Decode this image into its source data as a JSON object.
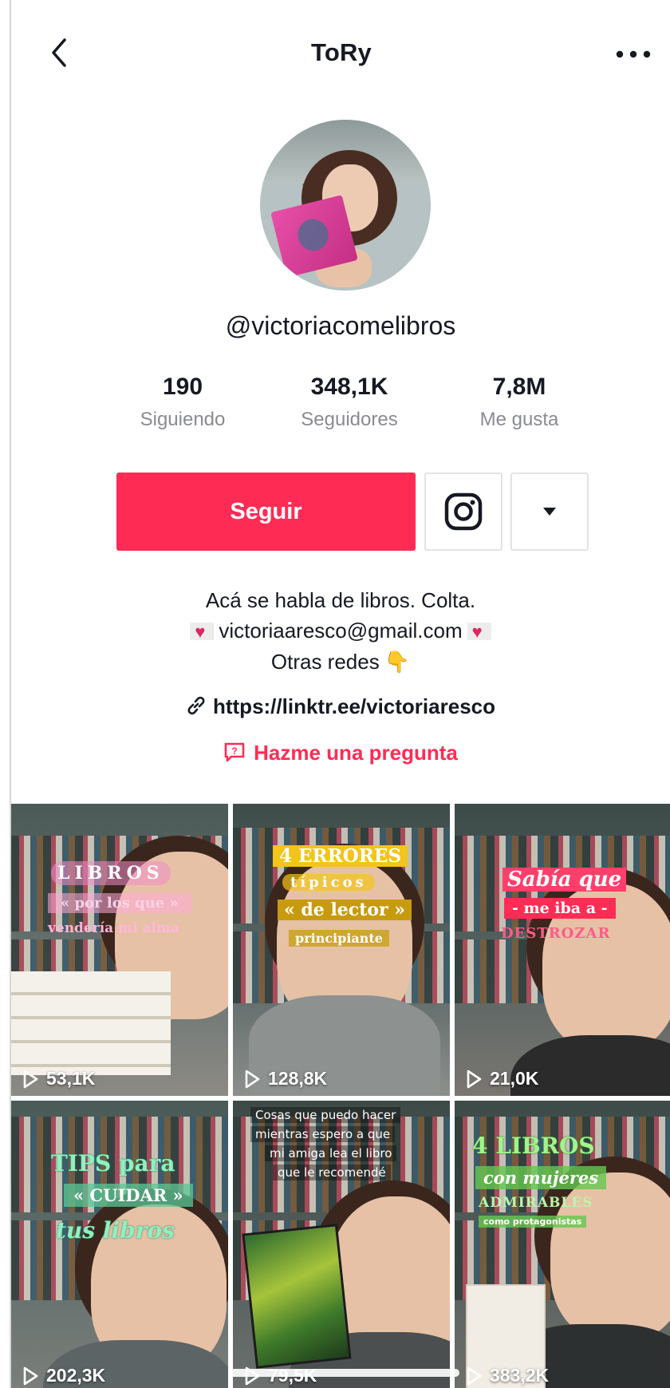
{
  "header": {
    "title": "ToRy"
  },
  "profile": {
    "username": "@victoriacomelibros",
    "stats": [
      {
        "value": "190",
        "label": "Siguiendo"
      },
      {
        "value": "348,1K",
        "label": "Seguidores"
      },
      {
        "value": "7,8M",
        "label": "Me gusta"
      }
    ],
    "follow_label": "Seguir",
    "bio": {
      "line1": "Acá se habla de libros. Colta.",
      "email": "victoriaaresco@gmail.com",
      "line3": "Otras redes"
    },
    "link": "https://linktr.ee/victoriaresco",
    "ask_label": "Hazme una pregunta"
  },
  "colors": {
    "accent": "#fe2c55",
    "text": "#161823",
    "muted": "#8a8b91"
  },
  "videos": [
    {
      "views": "53,1K",
      "overlay": [
        "LIBROS",
        "« por los que »",
        "vendería mi alma"
      ]
    },
    {
      "views": "128,8K",
      "overlay": [
        "4 ERRORES",
        "típicos",
        "« de lector »",
        "principiante"
      ]
    },
    {
      "views": "21,0K",
      "overlay": [
        "Sabía que",
        "- me iba a -",
        "DESTROZAR"
      ]
    },
    {
      "views": "202,3K",
      "overlay": [
        "TIPS para",
        "« CUIDAR »",
        "tus libros"
      ]
    },
    {
      "views": "79,5K",
      "overlay": [
        "Cosas que puedo hacer",
        "mientras espero a que",
        "mi amiga lea el libro",
        "que le recomendé"
      ]
    },
    {
      "views": "383,2K",
      "overlay": [
        "4 LIBROS",
        "con mujeres",
        "ADMIRABLES",
        "como protagonistas"
      ]
    }
  ],
  "icons": {
    "back": "chevron-left-icon",
    "more": "more-dots-icon",
    "instagram": "instagram-icon",
    "dropdown": "caret-down-icon",
    "link": "link-icon",
    "ask": "question-box-icon",
    "play": "play-icon"
  }
}
